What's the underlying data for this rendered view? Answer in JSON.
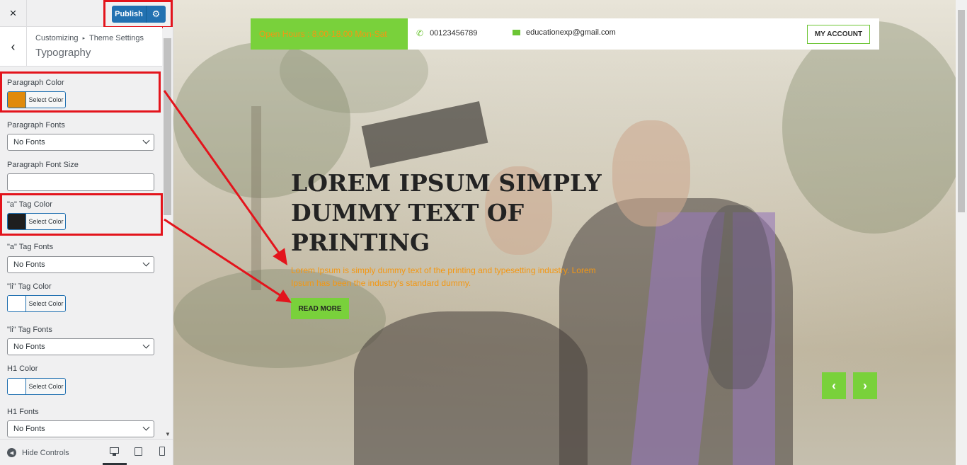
{
  "customizer": {
    "close_icon": "×",
    "publish_label": "Publish",
    "gear_icon": "⚙",
    "back_icon": "‹",
    "breadcrumb": {
      "root": "Customizing",
      "separator": "▸",
      "parent": "Theme Settings"
    },
    "section_title": "Typography",
    "controls": {
      "paragraph_color": {
        "label": "Paragraph Color",
        "button": "Select Color",
        "swatch": "#e08a0b"
      },
      "paragraph_fonts": {
        "label": "Paragraph Fonts",
        "value": "No Fonts"
      },
      "paragraph_font_size": {
        "label": "Paragraph Font Size",
        "value": ""
      },
      "a_tag_color": {
        "label": "\"a\" Tag Color",
        "button": "Select Color",
        "swatch": "#1e1e1e"
      },
      "a_tag_fonts": {
        "label": "\"a\" Tag Fonts",
        "value": "No Fonts"
      },
      "li_tag_color": {
        "label": "\"li\" Tag Color",
        "button": "Select Color",
        "swatch": "#ffffff"
      },
      "li_tag_fonts": {
        "label": "\"li\" Tag Fonts",
        "value": "No Fonts"
      },
      "h1_color": {
        "label": "H1 Color",
        "button": "Select Color",
        "swatch": "#ffffff"
      },
      "h1_fonts": {
        "label": "H1 Fonts",
        "value": "No Fonts"
      }
    },
    "footer": {
      "hide_controls": "Hide Controls",
      "hide_icon": "◀"
    }
  },
  "preview": {
    "info_bar": {
      "hours": "Open Hours : 8.00-18.00 Mon-Sat",
      "phone_icon": "✆",
      "phone": "00123456789",
      "email": "educationexp@gmail.com",
      "account_button": "MY ACCOUNT"
    },
    "hero": {
      "title": "LOREM IPSUM SIMPLY DUMMY TEXT OF PRINTING",
      "text": "Lorem Ipsum is simply dummy text of the printing and typesetting industry. Lorem Ipsum has been the industry's standard dummy.",
      "button": "READ MORE"
    },
    "slider": {
      "prev_icon": "‹",
      "next_icon": "›"
    }
  },
  "colors": {
    "accent_green": "#79d13b",
    "paragraph_orange": "#f39712",
    "wp_blue": "#2271b1",
    "annotation_red": "#e3141c"
  }
}
